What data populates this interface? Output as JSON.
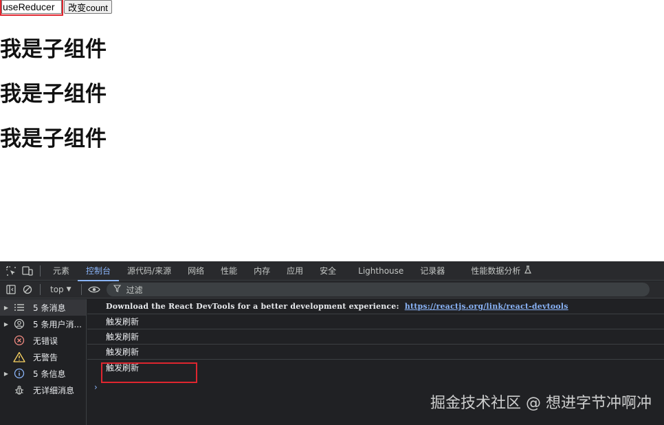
{
  "page": {
    "input_value": "useReducer",
    "button_label": "改变count",
    "child_headings": [
      "我是子组件",
      "我是子组件",
      "我是子组件"
    ]
  },
  "devtools": {
    "tabs": [
      "元素",
      "控制台",
      "源代码/来源",
      "网络",
      "性能",
      "内存",
      "应用",
      "安全",
      "Lighthouse",
      "记录器",
      "性能数据分析"
    ],
    "active_tab": "控制台",
    "context": "top",
    "filter_placeholder": "过滤",
    "sidebar": [
      {
        "label": "5 条消息",
        "icon": "list-icon",
        "expandable": true
      },
      {
        "label": "5 条用户消...",
        "icon": "user-icon",
        "expandable": true
      },
      {
        "label": "无错误",
        "icon": "error-icon",
        "expandable": false
      },
      {
        "label": "无警告",
        "icon": "warning-icon",
        "expandable": false
      },
      {
        "label": "5 条信息",
        "icon": "info-icon",
        "expandable": true
      },
      {
        "label": "无详细消息",
        "icon": "bug-icon",
        "expandable": false
      }
    ],
    "logs": {
      "devtools_message": "Download the React DevTools for a better development experience:",
      "devtools_link": "https://reactjs.org/link/react-devtools",
      "entries": [
        "触发刷新",
        "触发刷新",
        "触发刷新",
        "触发刷新"
      ]
    }
  },
  "watermark": "掘金技术社区 @ 想进字节冲啊冲",
  "colors": {
    "highlight": "#e0262f",
    "accent": "#8ab4f8",
    "devtools_bg": "#202124"
  }
}
